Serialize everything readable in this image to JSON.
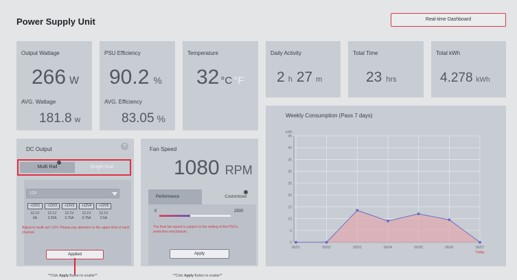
{
  "header": {
    "title": "Power Supply Unit",
    "dashboard_button": "Real-time Dashboard"
  },
  "stats": {
    "output_wattage": {
      "label": "Output Wattage",
      "value": "266",
      "unit": "w"
    },
    "psu_efficiency": {
      "label": "PSU Efficiency",
      "value": "90.2",
      "unit": "%"
    },
    "temperature": {
      "label": "Temperature",
      "value": "32",
      "unit_c": "°C",
      "unit_f": "°F"
    },
    "daily_activity": {
      "label": "Daily Activity",
      "hours": "2",
      "h_unit": "h",
      "minutes": "27",
      "m_unit": "m"
    },
    "total_time": {
      "label": "Total Time",
      "value": "23",
      "unit": "hrs"
    },
    "total_kwh": {
      "label": "Total kWh",
      "value": "4.278",
      "unit": "kWh"
    },
    "avg_wattage": {
      "label": "AVG. Wattage",
      "value": "181.8",
      "unit": "w"
    },
    "avg_efficiency": {
      "label": "AVG. Efficiency",
      "value": "83.05",
      "unit": "%"
    }
  },
  "dc_output": {
    "title": "DC Output",
    "help": "?",
    "tabs": {
      "multi": "Multi Rail",
      "single": "Single Rail"
    },
    "rail_select": "12V",
    "rails": [
      {
        "name": "+12V1",
        "voltage": "12.1V",
        "current": "0A"
      },
      {
        "name": "+12V2",
        "voltage": "12.1V",
        "current": "3.25A"
      },
      {
        "name": "+12V3",
        "voltage": "12.1V",
        "current": "0.75A"
      },
      {
        "name": "+12V4",
        "voltage": "12.1V",
        "current": "0.75A"
      },
      {
        "name": "+12V5",
        "voltage": "12.1V",
        "current": "2.5A"
      }
    ],
    "note": "Adjust to multi-rail +12V. Please pay attention to the upper limit of each channel.",
    "apply_button": "Applied",
    "hint_pre": "**Click ",
    "hint_bold": "Apply",
    "hint_post": " Button to enable**"
  },
  "fan_speed": {
    "title": "Fan Speed",
    "value": "1080",
    "unit": "RPM",
    "tabs": {
      "performance": "Performance",
      "customized": "Customized"
    },
    "slider_min": "0",
    "slider_max": "2500",
    "slider_value": 1080,
    "note": "The final fan speed is subject to the setting of the PSU's protection mechanism.",
    "apply_button": "Apply",
    "hint_pre": "**Click ",
    "hint_bold": "Apply",
    "hint_post": " Button to enable**"
  },
  "chart_data": {
    "type": "line",
    "title": "Weekly Consumption (Pass 7 days)",
    "ylabel": "kWh",
    "ylim": [
      0,
      45
    ],
    "yticks": [
      0,
      5,
      10,
      15,
      20,
      25,
      30,
      35,
      40,
      45
    ],
    "x": [
      "06/01",
      "06/02",
      "06/03",
      "06/04",
      "06/05",
      "06/06",
      "06/07"
    ],
    "today_label": "Today",
    "series": [
      {
        "values": [
          0,
          0,
          13.5,
          9,
          12,
          9.5,
          0
        ]
      }
    ],
    "colors": {
      "line": "#6a6ec6",
      "fill": "#e2a6aa"
    }
  }
}
